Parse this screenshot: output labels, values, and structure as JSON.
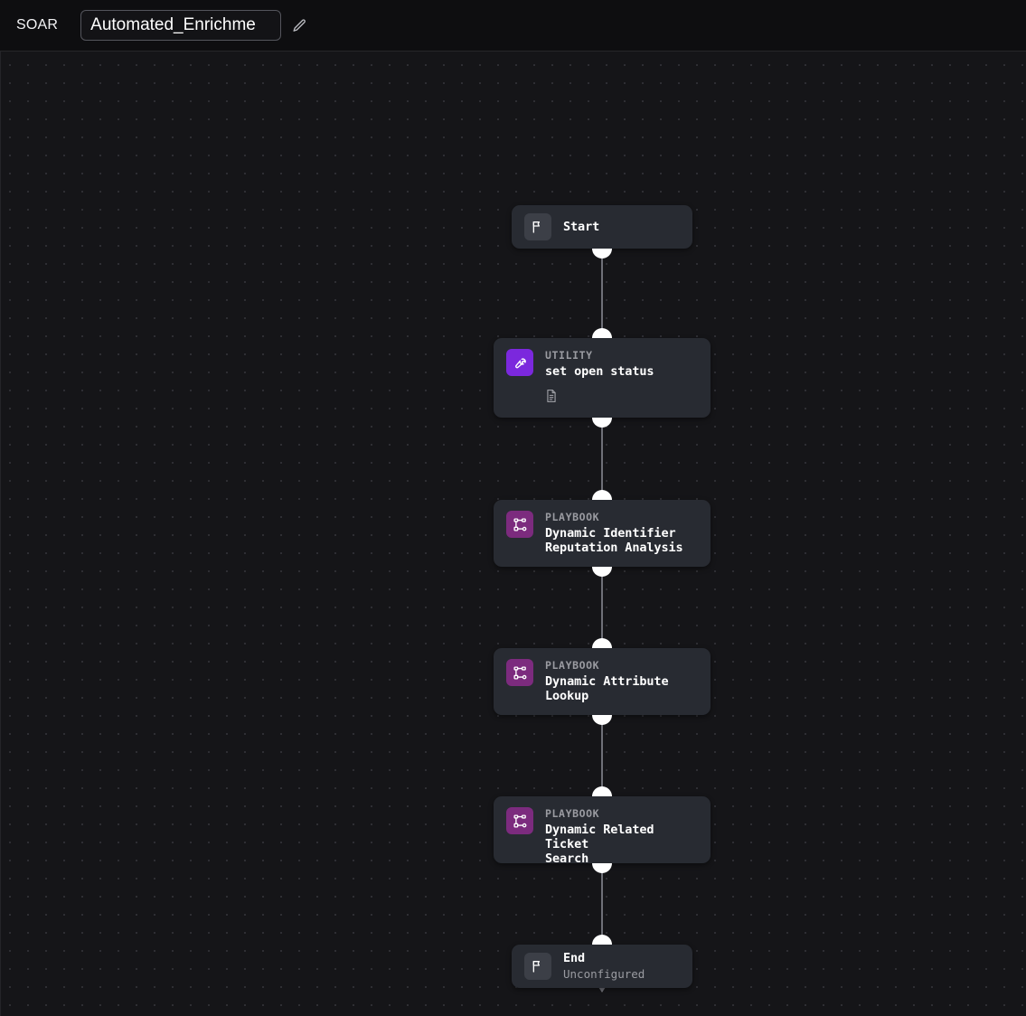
{
  "header": {
    "app_label": "SOAR",
    "title_value": "Automated_Enrichme",
    "title_placeholder": "Playbook name",
    "edit_icon": "pencil-icon"
  },
  "canvas": {
    "grid": true,
    "background_color": "#151518",
    "grid_dot_color": "#2e2e33"
  },
  "nodes": [
    {
      "id": "start",
      "type": "terminal",
      "icon": "flag-icon",
      "icon_color": "#3c3f47",
      "kind": "",
      "title": "Start",
      "subtitle": "",
      "has_doc_icon": false
    },
    {
      "id": "set-open-status",
      "type": "utility",
      "icon": "wrench-icon",
      "icon_color": "#7b28dd",
      "kind": "UTILITY",
      "title": "set open status",
      "subtitle": "",
      "has_doc_icon": true,
      "doc_icon": "document-icon"
    },
    {
      "id": "dynamic-identifier-reputation-analysis",
      "type": "playbook",
      "icon": "workflow-icon",
      "icon_color": "#7c2b7e",
      "kind": "PLAYBOOK",
      "title": "Dynamic Identifier\nReputation Analysis",
      "subtitle": "",
      "has_doc_icon": false
    },
    {
      "id": "dynamic-attribute-lookup",
      "type": "playbook",
      "icon": "workflow-icon",
      "icon_color": "#7c2b7e",
      "kind": "PLAYBOOK",
      "title": "Dynamic Attribute\nLookup",
      "subtitle": "",
      "has_doc_icon": false
    },
    {
      "id": "dynamic-related-ticket-search",
      "type": "playbook",
      "icon": "workflow-icon",
      "icon_color": "#7c2b7e",
      "kind": "PLAYBOOK",
      "title": "Dynamic Related Ticket\nSearch",
      "subtitle": "",
      "has_doc_icon": false
    },
    {
      "id": "end",
      "type": "terminal",
      "icon": "flag-icon",
      "icon_color": "#3c3f47",
      "kind": "",
      "title": "End",
      "subtitle": "Unconfigured",
      "has_doc_icon": false
    }
  ],
  "edges": [
    {
      "from": "start",
      "to": "set-open-status"
    },
    {
      "from": "set-open-status",
      "to": "dynamic-identifier-reputation-analysis"
    },
    {
      "from": "dynamic-identifier-reputation-analysis",
      "to": "dynamic-attribute-lookup"
    },
    {
      "from": "dynamic-attribute-lookup",
      "to": "dynamic-related-ticket-search"
    },
    {
      "from": "dynamic-related-ticket-search",
      "to": "end"
    }
  ]
}
